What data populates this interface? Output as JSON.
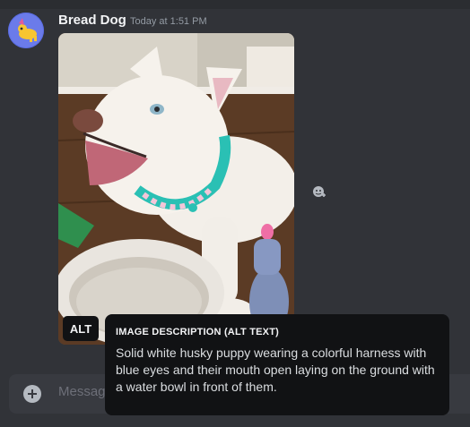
{
  "message": {
    "author": "Bread Dog",
    "timestamp": "Today at 1:51 PM"
  },
  "attachment": {
    "alt_badge": "ALT"
  },
  "tooltip": {
    "title": "IMAGE DESCRIPTION (ALT TEXT)",
    "body": "Solid white husky puppy wearing a colorful harness with blue eyes and their mouth open laying on the ground with a water bowl in front of them."
  },
  "composer": {
    "placeholder": "Message"
  },
  "icons": {
    "avatar": "avatar-dog-icon",
    "hover": "add-reaction-icon",
    "add": "plus-circle-icon"
  },
  "colors": {
    "background": "#313338",
    "tooltip_bg": "#111214",
    "composer_bg": "#383a40",
    "text_muted": "#949ba4",
    "text_primary": "#f2f3f5"
  }
}
